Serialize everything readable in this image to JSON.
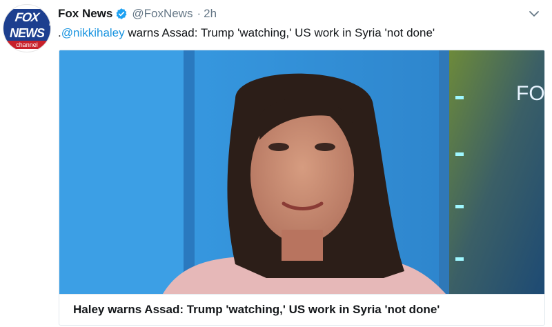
{
  "tweet": {
    "author_name": "Fox News",
    "handle": "@FoxNews",
    "separator": "·",
    "time": "2h",
    "verified": true,
    "avatar": {
      "logo_top": "FOX",
      "logo_mid": "NEWS",
      "logo_bottom": "channel"
    },
    "text_prefix": ".",
    "mention": "@nikkihaley",
    "text_body": " warns Assad: Trump 'watching,' US work in Syria 'not done'",
    "menu_icon": "chevron-down-icon"
  },
  "card": {
    "title": "Haley warns Assad: Trump 'watching,' US work in Syria 'not done'",
    "backdrop_text": "FO"
  },
  "colors": {
    "link": "#1b95e0",
    "verified": "#1da1f2",
    "muted": "#657786",
    "brand_blue": "#1d3f8f",
    "brand_red": "#c8202a"
  }
}
